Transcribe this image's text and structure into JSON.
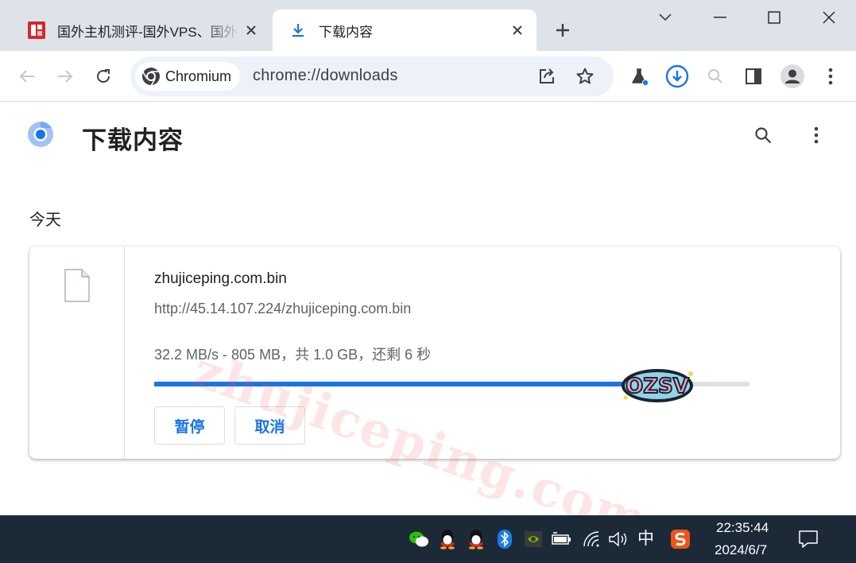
{
  "tabs": [
    {
      "title": "国外主机测评-国外VPS、国外",
      "favicon": "site-logo-icon",
      "active": false
    },
    {
      "title": "下载内容",
      "favicon": "download-icon",
      "active": true
    }
  ],
  "window_controls": [
    "tab-search-chevron-icon",
    "minimize-icon",
    "maximize-icon",
    "close-icon"
  ],
  "toolbar": {
    "chip_label": "Chromium",
    "url": "chrome://downloads",
    "icons": [
      "back-icon",
      "forward-icon",
      "reload-icon",
      "share-icon",
      "bookmark-star-icon",
      "labs-flask-icon",
      "downloads-icon",
      "zoom-icon",
      "side-panel-icon",
      "profile-avatar-icon",
      "more-menu-icon"
    ]
  },
  "page": {
    "title": "下载内容",
    "date_header": "今天",
    "watermark": "zhujiceping.com",
    "download": {
      "file_name": "zhujiceping.com.bin",
      "url": "http://45.14.107.224/zhujiceping.com.bin",
      "status": "32.2 MB/s - 805 MB，共 1.0 GB，还剩 6 秒",
      "progress_fraction": 0.786,
      "pause_label": "暂停",
      "cancel_label": "取消"
    },
    "sticker_text": "OZSV"
  },
  "taskbar": {
    "tray_icons": [
      "wechat-icon",
      "qq-icon",
      "qq-icon",
      "bluetooth-icon",
      "nvidia-icon",
      "battery-icon",
      "wifi-icon",
      "volume-icon",
      "sogou-icon",
      "notification-icon"
    ],
    "ime": "中",
    "time": "22:35:44",
    "date": "2024/6/7"
  },
  "colors": {
    "accent": "#1a73e8",
    "tabstrip": "#dee3ea",
    "omnibox": "#edf2fa",
    "taskbar": "#1c2a38"
  }
}
